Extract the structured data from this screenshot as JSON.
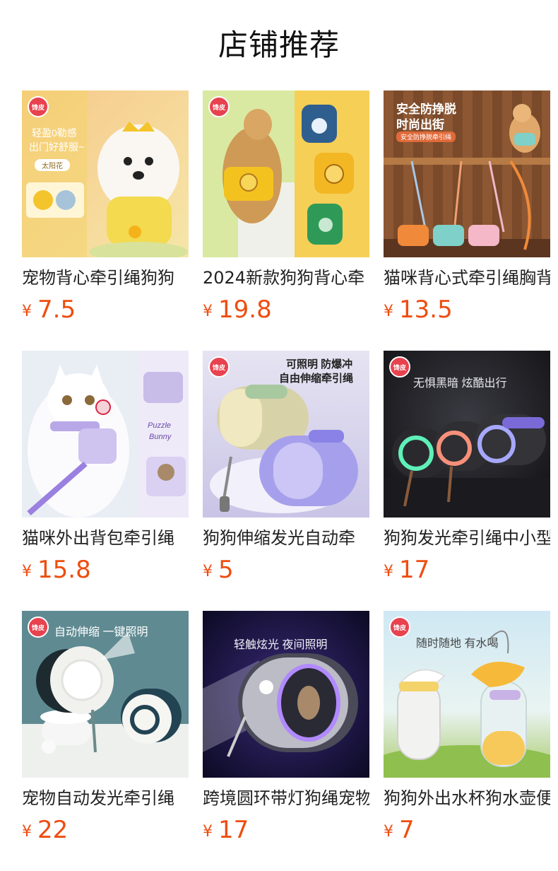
{
  "section_title": "店铺推荐",
  "currency_symbol": "¥",
  "brand_badge": "馋皮狗",
  "products": [
    {
      "name": "宠物背心牵引绳狗狗",
      "price": "7.5",
      "overlay": [
        "轻盈0勒感",
        "出门好舒服~",
        "太阳花"
      ]
    },
    {
      "name": "2024新款狗狗背心牵",
      "price": "19.8",
      "overlay": []
    },
    {
      "name": "猫咪背心式牵引绳胸背",
      "price": "13.5",
      "overlay": [
        "安全防挣脱",
        "时尚出街",
        "安全防挣脱牵引绳"
      ]
    },
    {
      "name": "猫咪外出背包牵引绳",
      "price": "15.8",
      "overlay": [
        "Puzzle",
        "Bunny"
      ]
    },
    {
      "name": "狗狗伸缩发光自动牵",
      "price": "5",
      "overlay": [
        "可照明  防爆冲",
        "自由伸缩牵引绳"
      ]
    },
    {
      "name": "狗狗发光牵引绳中小型",
      "price": "17",
      "overlay": [
        "无惧黑暗  炫酷出行"
      ]
    },
    {
      "name": "宠物自动发光牵引绳",
      "price": "22",
      "overlay": [
        "自动伸缩 一键照明"
      ]
    },
    {
      "name": "跨境圆环带灯狗绳宠物",
      "price": "17",
      "overlay": [
        "轻触炫光 夜间照明"
      ]
    },
    {
      "name": "狗狗外出水杯狗水壶便",
      "price": "7",
      "overlay": [
        "随时随地  有水喝"
      ]
    }
  ],
  "colors": {
    "price": "#ee4d10",
    "title": "#111111",
    "product_name": "#222222"
  }
}
